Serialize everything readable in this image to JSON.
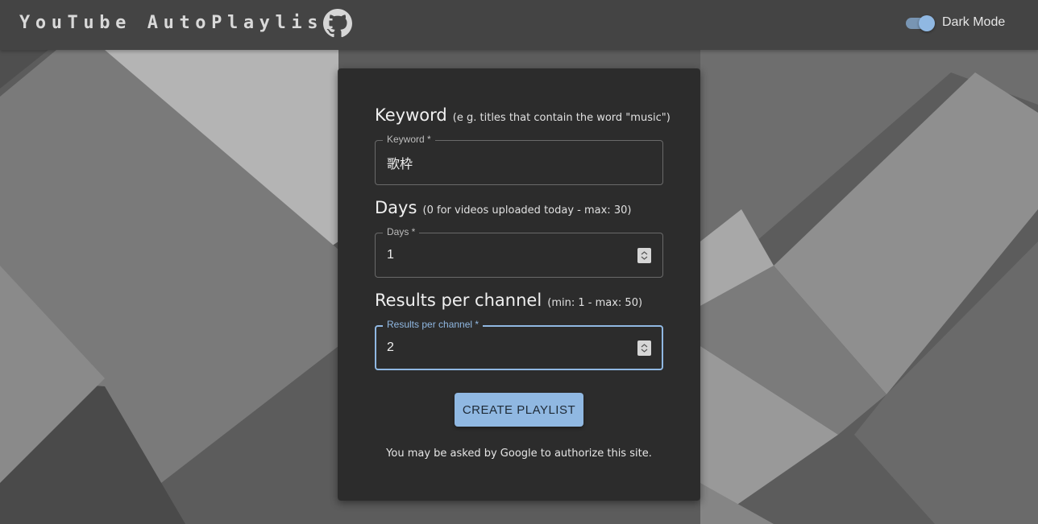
{
  "app": {
    "title": "YouTube AutoPlaylist",
    "github_icon": "github-icon",
    "dark_mode_label": "Dark Mode",
    "dark_mode_on": true
  },
  "form": {
    "keyword": {
      "heading": "Keyword",
      "hint": "(e g. titles that contain the word \"music\")",
      "label": "Keyword *",
      "value": "歌枠"
    },
    "days": {
      "heading": "Days",
      "hint": "(0 for videos uploaded today - max: 30)",
      "label": "Days *",
      "value": "1"
    },
    "results": {
      "heading": "Results per channel",
      "hint": "(min: 1 - max: 50)",
      "label": "Results per channel *",
      "value": "2"
    },
    "create_button": "CREATE PLAYLIST",
    "auth_note": "You may be asked by Google to authorize this site."
  },
  "colors": {
    "accent": "#90b8e2",
    "card": "#262626",
    "appbar": "#3c3c3c"
  }
}
